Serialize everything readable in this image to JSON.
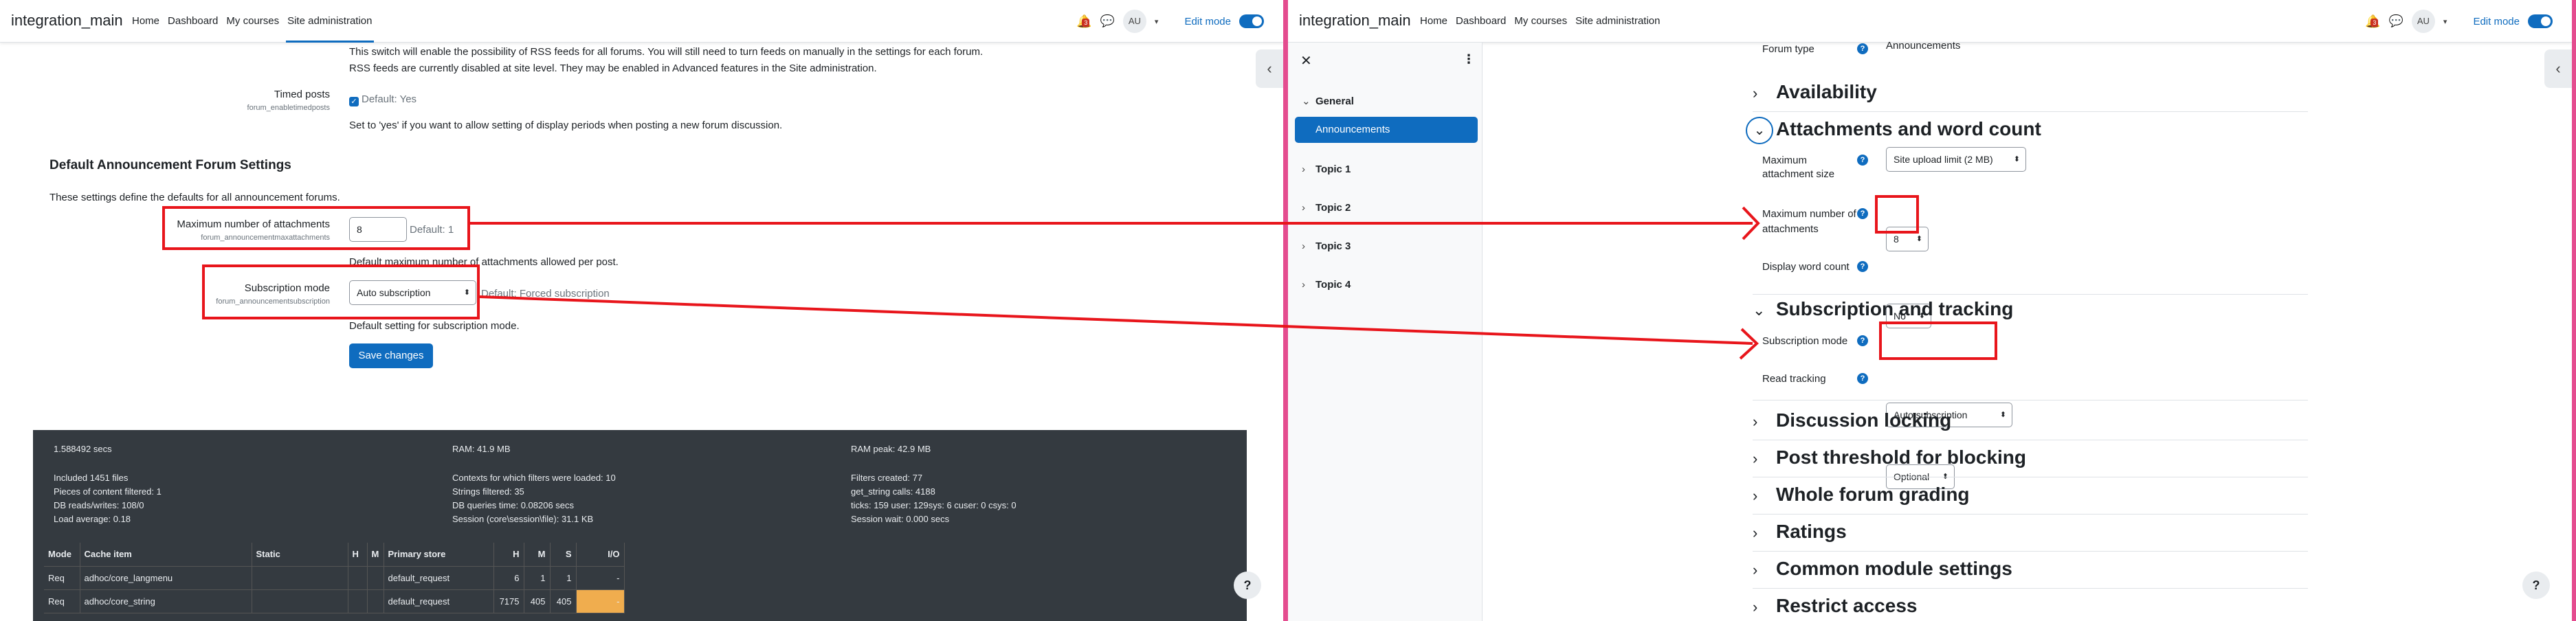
{
  "left": {
    "brand": "integration_main",
    "nav": [
      "Home",
      "Dashboard",
      "My courses",
      "Site administration"
    ],
    "notif_count": "3",
    "avatar": "AU",
    "edit_mode": "Edit mode",
    "rss_line1": "This switch will enable the possibility of RSS feeds for all forums. You will still need to turn feeds on manually in the settings for each forum.",
    "rss_line2": "RSS feeds are currently disabled at site level. They may be enabled in Advanced features in the Site administration.",
    "timed_label": "Timed posts",
    "timed_key": "forum_enabletimedposts",
    "timed_default": "Default: Yes",
    "timed_desc": "Set to 'yes' if you want to allow setting of display periods when posting a new forum discussion.",
    "section_title": "Default Announcement Forum Settings",
    "section_desc": "These settings define the defaults for all announcement forums.",
    "attach_label": "Maximum number of attachments",
    "attach_key": "forum_announcementmaxattachments",
    "attach_value": "8",
    "attach_default": "Default: 1",
    "attach_desc": "Default maximum number of attachments allowed per post.",
    "sub_label": "Subscription mode",
    "sub_key": "forum_announcementsubscription",
    "sub_value": "Auto subscription",
    "sub_default": "Default: Forced subscription",
    "sub_desc": "Default setting for subscription mode.",
    "save": "Save changes",
    "perf": {
      "secs": "1.588492 secs",
      "ram": "RAM: 41.9 MB",
      "ram_peak": "RAM peak: 42.9 MB",
      "included": "Included 1451 files",
      "filtered": "Pieces of content filtered: 1",
      "db_rw": "DB reads/writes: 108/0",
      "load": "Load average: 0.18",
      "contexts": "Contexts for which filters were loaded: 10",
      "strings": "Strings filtered: 35",
      "db_time": "DB queries time: 0.08206 secs",
      "session": "Session (core\\session\\file): 31.1 KB",
      "filters_created": "Filters created: 77",
      "get_string": "get_string calls: 4188",
      "ticks": "ticks: 159 user: 129sys: 6 cuser: 0 csys: 0",
      "session_wait": "Session wait: 0.000 secs"
    },
    "cache_headers": [
      "Mode",
      "Cache item",
      "Static",
      "H",
      "M",
      "Primary store",
      "H",
      "M",
      "S",
      "I/O"
    ],
    "cache_rows": [
      [
        "Req",
        "adhoc/core_langmenu",
        "",
        "",
        "",
        "default_request",
        "6",
        "1",
        "1",
        "-"
      ],
      [
        "Req",
        "adhoc/core_string",
        "",
        "",
        "",
        "default_request",
        "7175",
        "405",
        "405",
        "-"
      ]
    ],
    "help": "?"
  },
  "right": {
    "brand": "integration_main",
    "nav": [
      "Home",
      "Dashboard",
      "My courses",
      "Site administration"
    ],
    "notif_count": "3",
    "avatar": "AU",
    "edit_mode": "Edit mode",
    "drawer": {
      "general": "General",
      "active": "Announcements",
      "topics": [
        "Topic 1",
        "Topic 2",
        "Topic 3",
        "Topic 4"
      ]
    },
    "forum_type_label": "Forum type",
    "forum_type_value": "Announcements",
    "sections": {
      "availability": "Availability",
      "attachments": "Attachments and word count",
      "subscription": "Subscription and tracking",
      "discussion": "Discussion locking",
      "threshold": "Post threshold for blocking",
      "grading": "Whole forum grading",
      "ratings": "Ratings",
      "common": "Common module settings",
      "restrict": "Restrict access"
    },
    "max_size_label1": "Maximum",
    "max_size_label2": "attachment size",
    "max_size_value": "Site upload limit (2 MB)",
    "max_attach_label1": "Maximum number of",
    "max_attach_label2": "attachments",
    "max_attach_value": "8",
    "word_count_label": "Display word count",
    "word_count_value": "No",
    "sub_mode_label": "Subscription mode",
    "sub_mode_value": "Auto subscription",
    "read_tracking_label": "Read tracking",
    "read_tracking_value": "Optional",
    "help": "?"
  },
  "colors": {
    "primary": "#0f6cbf",
    "annotation_red": "#e8151b",
    "divider_pink": "#e44c8f",
    "footer_dark": "#343a40"
  }
}
